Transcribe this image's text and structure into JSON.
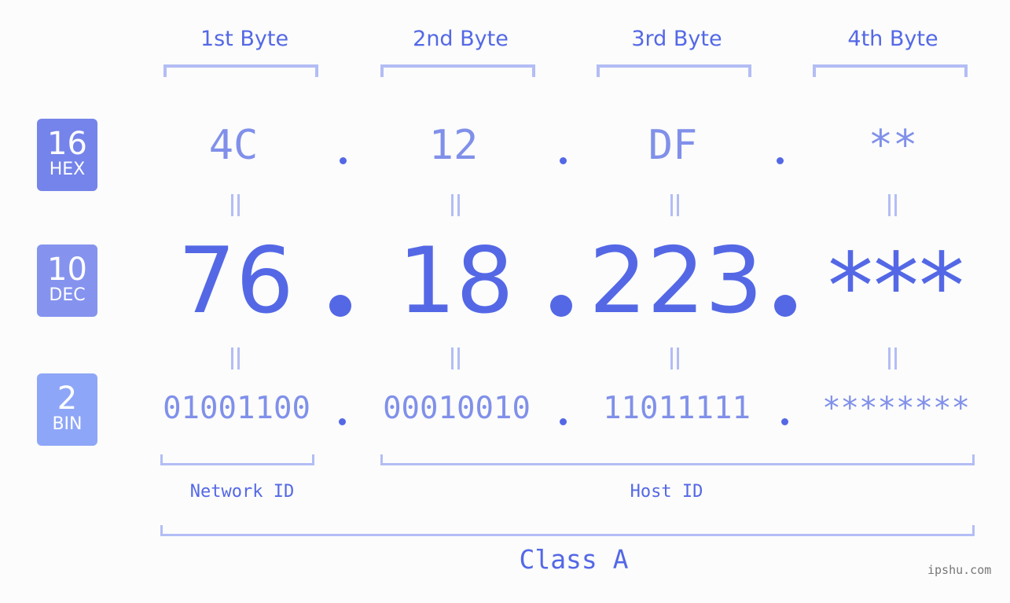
{
  "bytes": [
    {
      "header": "1st Byte",
      "hex": "4C",
      "dec": "76",
      "bin": "01001100"
    },
    {
      "header": "2nd Byte",
      "hex": "12",
      "dec": "18",
      "bin": "00010010"
    },
    {
      "header": "3rd Byte",
      "hex": "DF",
      "dec": "223",
      "bin": "11011111"
    },
    {
      "header": "4th Byte",
      "hex": "**",
      "dec": "***",
      "bin": "********"
    }
  ],
  "badges": {
    "hex": {
      "num": "16",
      "label": "HEX",
      "color": "#7584ea"
    },
    "dec": {
      "num": "10",
      "label": "DEC",
      "color": "#8593ef"
    },
    "bin": {
      "num": "2",
      "label": "BIN",
      "color": "#8ea6f7"
    }
  },
  "separator": ".",
  "network_label": "Network ID",
  "host_label": "Host ID",
  "class_label": "Class A",
  "watermark": "ipshu.com",
  "colors": {
    "accent": "#5468e6",
    "light": "#8090ea",
    "bracket": "#b3bdf5"
  }
}
